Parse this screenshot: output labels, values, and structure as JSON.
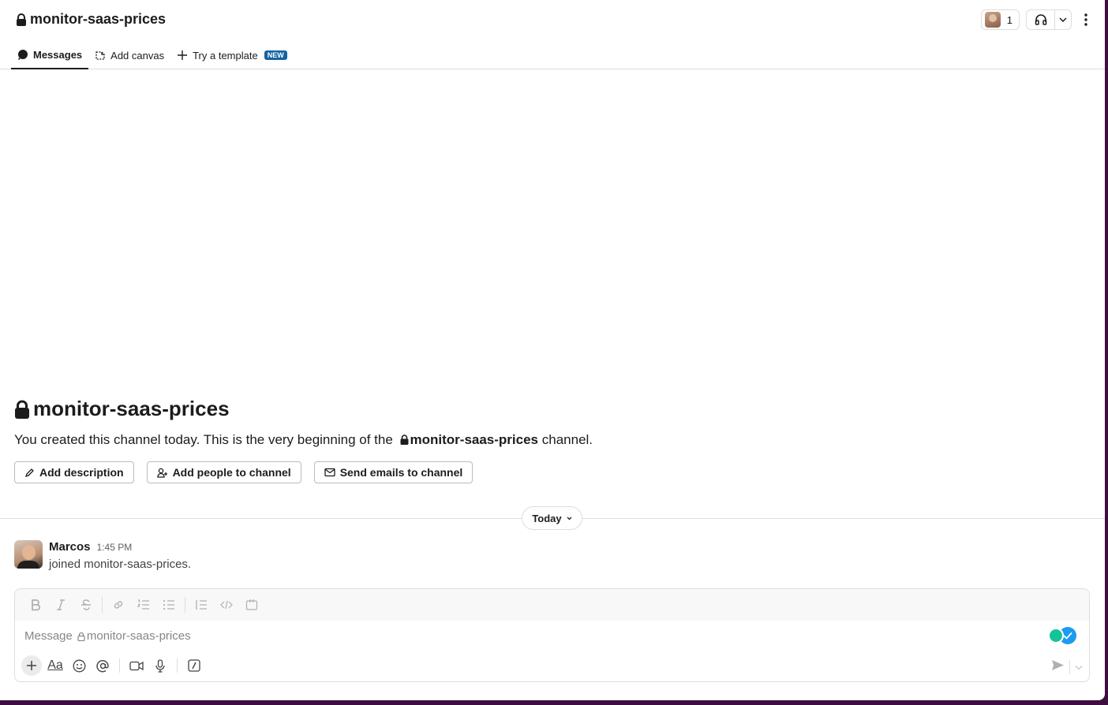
{
  "header": {
    "channel_name": "monitor-saas-prices",
    "members_count": "1",
    "tabs": [
      {
        "label": "Messages"
      },
      {
        "label": "Add canvas"
      },
      {
        "label": "Try a template",
        "badge": "NEW"
      }
    ]
  },
  "intro": {
    "title": "monitor-saas-prices",
    "text_prefix": "You created this channel today. This is the very beginning of the",
    "channel_name": "monitor-saas-prices",
    "text_suffix": "channel.",
    "actions": [
      {
        "label": "Add description",
        "icon": "pencil-icon"
      },
      {
        "label": "Add people to channel",
        "icon": "add-person-icon"
      },
      {
        "label": "Send emails to channel",
        "icon": "email-icon"
      }
    ]
  },
  "divider": {
    "label": "Today"
  },
  "message": {
    "author": "Marcos",
    "time": "1:45 PM",
    "text": "joined monitor-saas-prices."
  },
  "composer": {
    "placeholder_prefix": "Message",
    "placeholder_channel": "monitor-saas-prices",
    "format_label": "Aa"
  },
  "colors": {
    "accent": "#1264a3",
    "workspace_bg": "#3f0e40"
  }
}
